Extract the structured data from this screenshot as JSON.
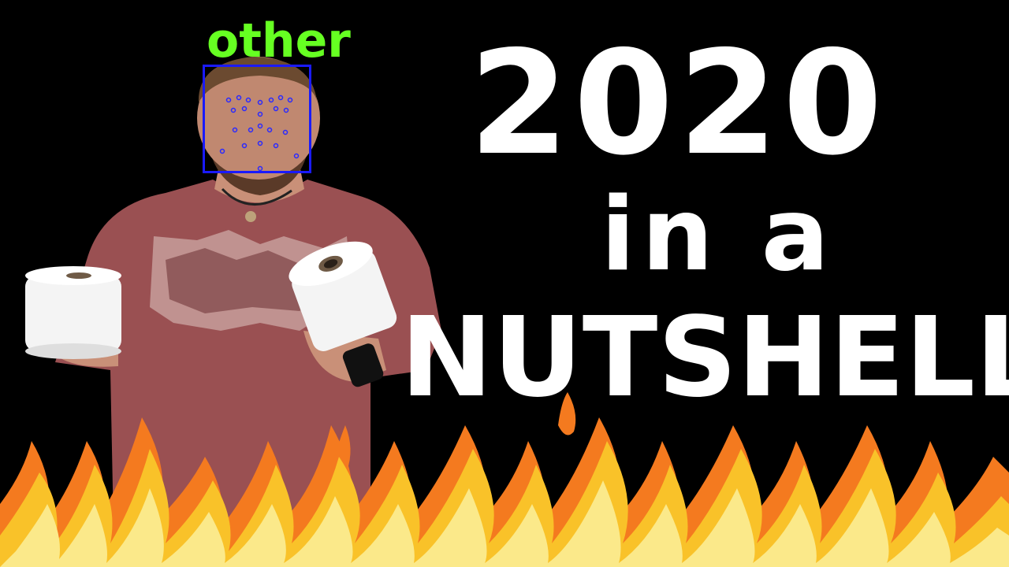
{
  "headline": {
    "line1": "2020",
    "line2": "in a",
    "line3": "NUTSHELL"
  },
  "detection": {
    "label": "other",
    "label_color": "#66ff22",
    "box_color": "#1a1aff"
  },
  "colors": {
    "background": "#000000",
    "shirt": "#9a5052",
    "flame_outer": "#f47a1f",
    "flame_mid": "#f9c229",
    "flame_inner": "#fbe98a"
  }
}
